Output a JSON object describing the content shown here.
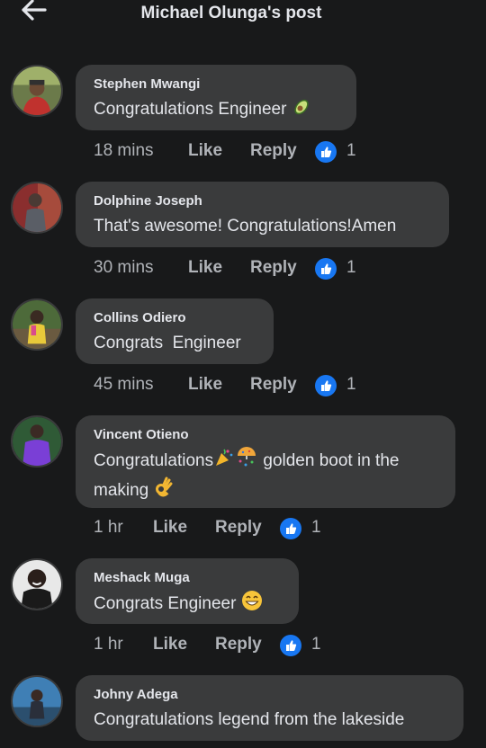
{
  "header": {
    "title": "Michael Olunga's post"
  },
  "comments": [
    {
      "author": "Stephen Mwangi",
      "text": "Congratulations Engineer",
      "time": "18 mins",
      "like": "Like",
      "reply": "Reply",
      "reactions": "1"
    },
    {
      "author": "Dolphine Joseph",
      "text": "That's awesome! Congratulations!Amen",
      "time": "30 mins",
      "like": "Like",
      "reply": "Reply",
      "reactions": "1"
    },
    {
      "author": "Collins Odiero",
      "text": "Congrats  Engineer",
      "time": "45 mins",
      "like": "Like",
      "reply": "Reply",
      "reactions": "1"
    },
    {
      "author": "Vincent Otieno",
      "text_a": "Congratulations",
      "text_b": "golden boot in the",
      "text_c": "making",
      "time": "1 hr",
      "like": "Like",
      "reply": "Reply",
      "reactions": "1"
    },
    {
      "author": "Meshack Muga",
      "text": "Congrats Engineer",
      "time": "1 hr",
      "like": "Like",
      "reply": "Reply",
      "reactions": "1"
    },
    {
      "author": "Johny Adega",
      "text": "Congratulations legend from the lakeside"
    }
  ],
  "colors": {
    "background": "#18191a",
    "bubble": "#3a3b3c",
    "like_reaction": "#1877f2",
    "meta_text": "#b0b3b8"
  }
}
